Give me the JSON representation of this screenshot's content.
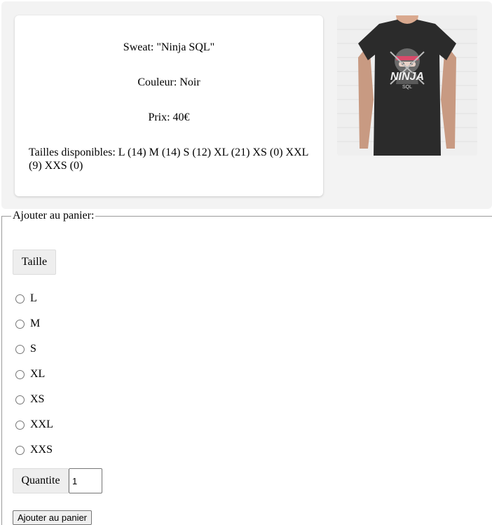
{
  "product": {
    "title": "Sweat: \"Ninja SQL\"",
    "color": "Couleur: Noir",
    "price": "Prix: 40€",
    "sizes_available": "Tailles disponibles: L (14) M (14) S (12) XL (21) XS (0) XXL (9) XXS (0)",
    "image_logo_text": "NINJA",
    "image_logo_sub": "SQL"
  },
  "cart": {
    "legend": "Ajouter au panier:",
    "size_label": "Taille",
    "size_options": [
      "L",
      "M",
      "S",
      "XL",
      "XS",
      "XXL",
      "XXS"
    ],
    "quantity_label": "Quantite",
    "quantity_value": "1",
    "submit_label": "Ajouter au panier"
  }
}
